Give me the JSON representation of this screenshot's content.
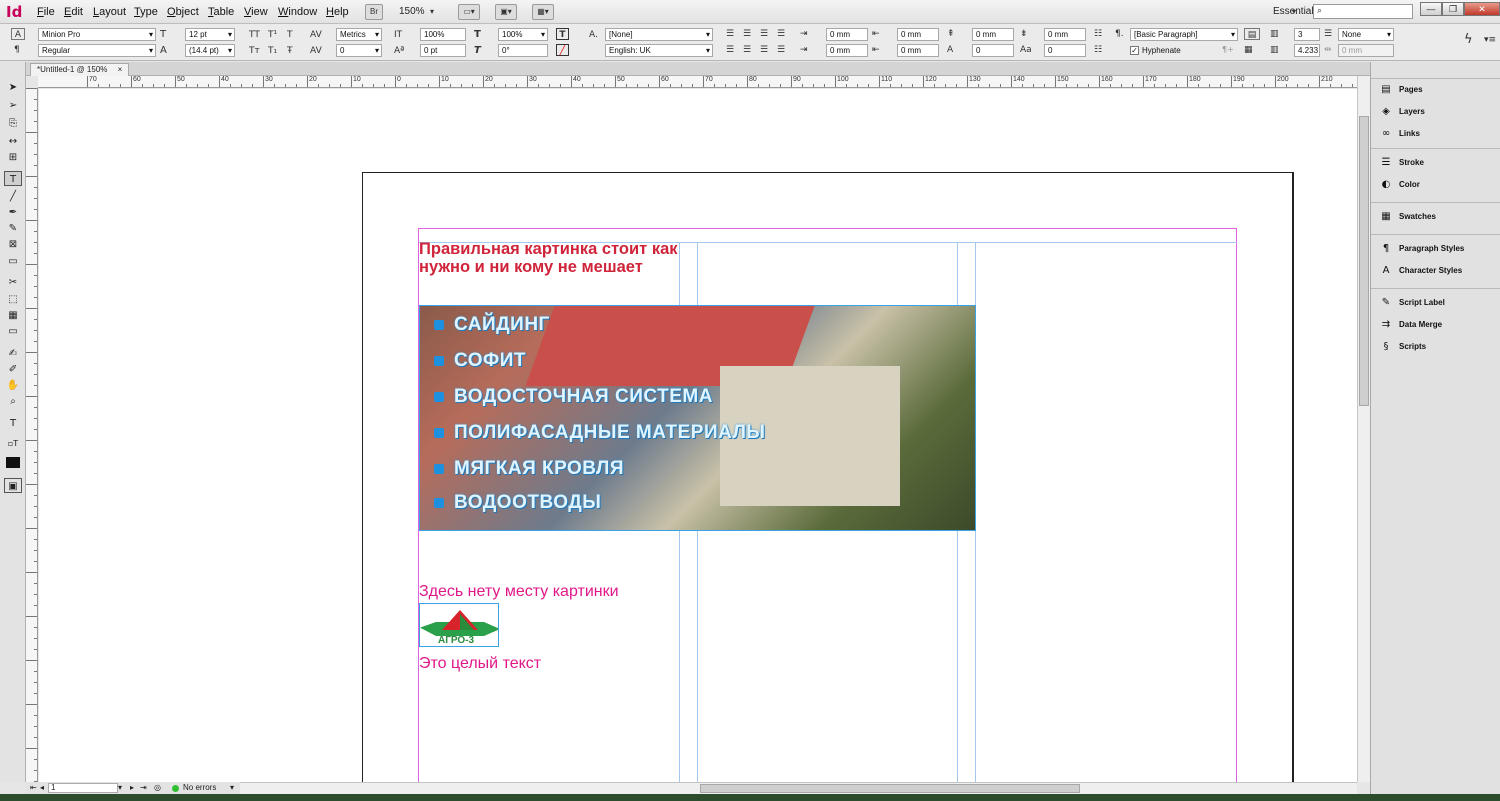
{
  "app": {
    "logo": "Id",
    "menu": [
      "File",
      "Edit",
      "Layout",
      "Type",
      "Object",
      "Table",
      "View",
      "Window",
      "Help"
    ],
    "bridge_btn": "Br",
    "zoom": "150%",
    "workspace": "Essentials",
    "search_placeholder": ""
  },
  "control": {
    "font_family": "Minion Pro",
    "font_style": "Regular",
    "font_size": "12 pt",
    "leading": "(14.4 pt)",
    "kerning": "Metrics",
    "tracking": "0",
    "vscale": "100%",
    "hscale": "100%",
    "baseline": "0 pt",
    "skew": "0°",
    "char_style": "[None]",
    "language": "English: UK",
    "indent_left": "0 mm",
    "indent_right": "0 mm",
    "first_indent": "0 mm",
    "last_indent": "0 mm",
    "space_before": "0 mm",
    "space_after": "0 mm",
    "drop_lines": "0",
    "drop_chars": "0",
    "para_style": "[Basic Paragraph]",
    "hyphenate": "Hyphenate",
    "columns": "3",
    "gutter": "4.233",
    "span": "None",
    "span_gap": "0 mm"
  },
  "document": {
    "tab_title": "*Untitled-1 @ 150%",
    "heading": "Правильная картинка стоит как нужно и ни кому не мешает",
    "banner_items": [
      "САЙДИНГ",
      "СОФИТ",
      "ВОДОСТОЧНАЯ СИСТЕМА",
      "ПОЛИФАСАДНЫЕ МАТЕРИАЛЫ",
      "МЯГКАЯ КРОВЛЯ",
      "ВОДООТВОДЫ"
    ],
    "caption1": "Здесь нету месту картинки",
    "logo_text": "АГРО-3",
    "caption2": "Это целый текст"
  },
  "ruler": {
    "h_labels": [
      "70",
      "60",
      "50",
      "40",
      "30",
      "20",
      "10",
      "0",
      "10",
      "20",
      "30",
      "40",
      "50",
      "60",
      "70",
      "80",
      "90",
      "100",
      "110",
      "120",
      "130",
      "140",
      "150",
      "160",
      "170",
      "180",
      "190",
      "200",
      "210",
      "220"
    ]
  },
  "panels": {
    "group1": [
      "Pages",
      "Layers",
      "Links"
    ],
    "group2": [
      "Stroke",
      "Color"
    ],
    "group3": [
      "Swatches"
    ],
    "group4": [
      "Paragraph Styles",
      "Character Styles"
    ],
    "group5": [
      "Script Label",
      "Data Merge",
      "Scripts"
    ]
  },
  "status": {
    "page": "1",
    "preflight": "No errors"
  },
  "colors": {
    "heading": "#d0243a",
    "caption": "#e0188a",
    "margin": "#e061e0",
    "guide": "#a5c8ee"
  }
}
